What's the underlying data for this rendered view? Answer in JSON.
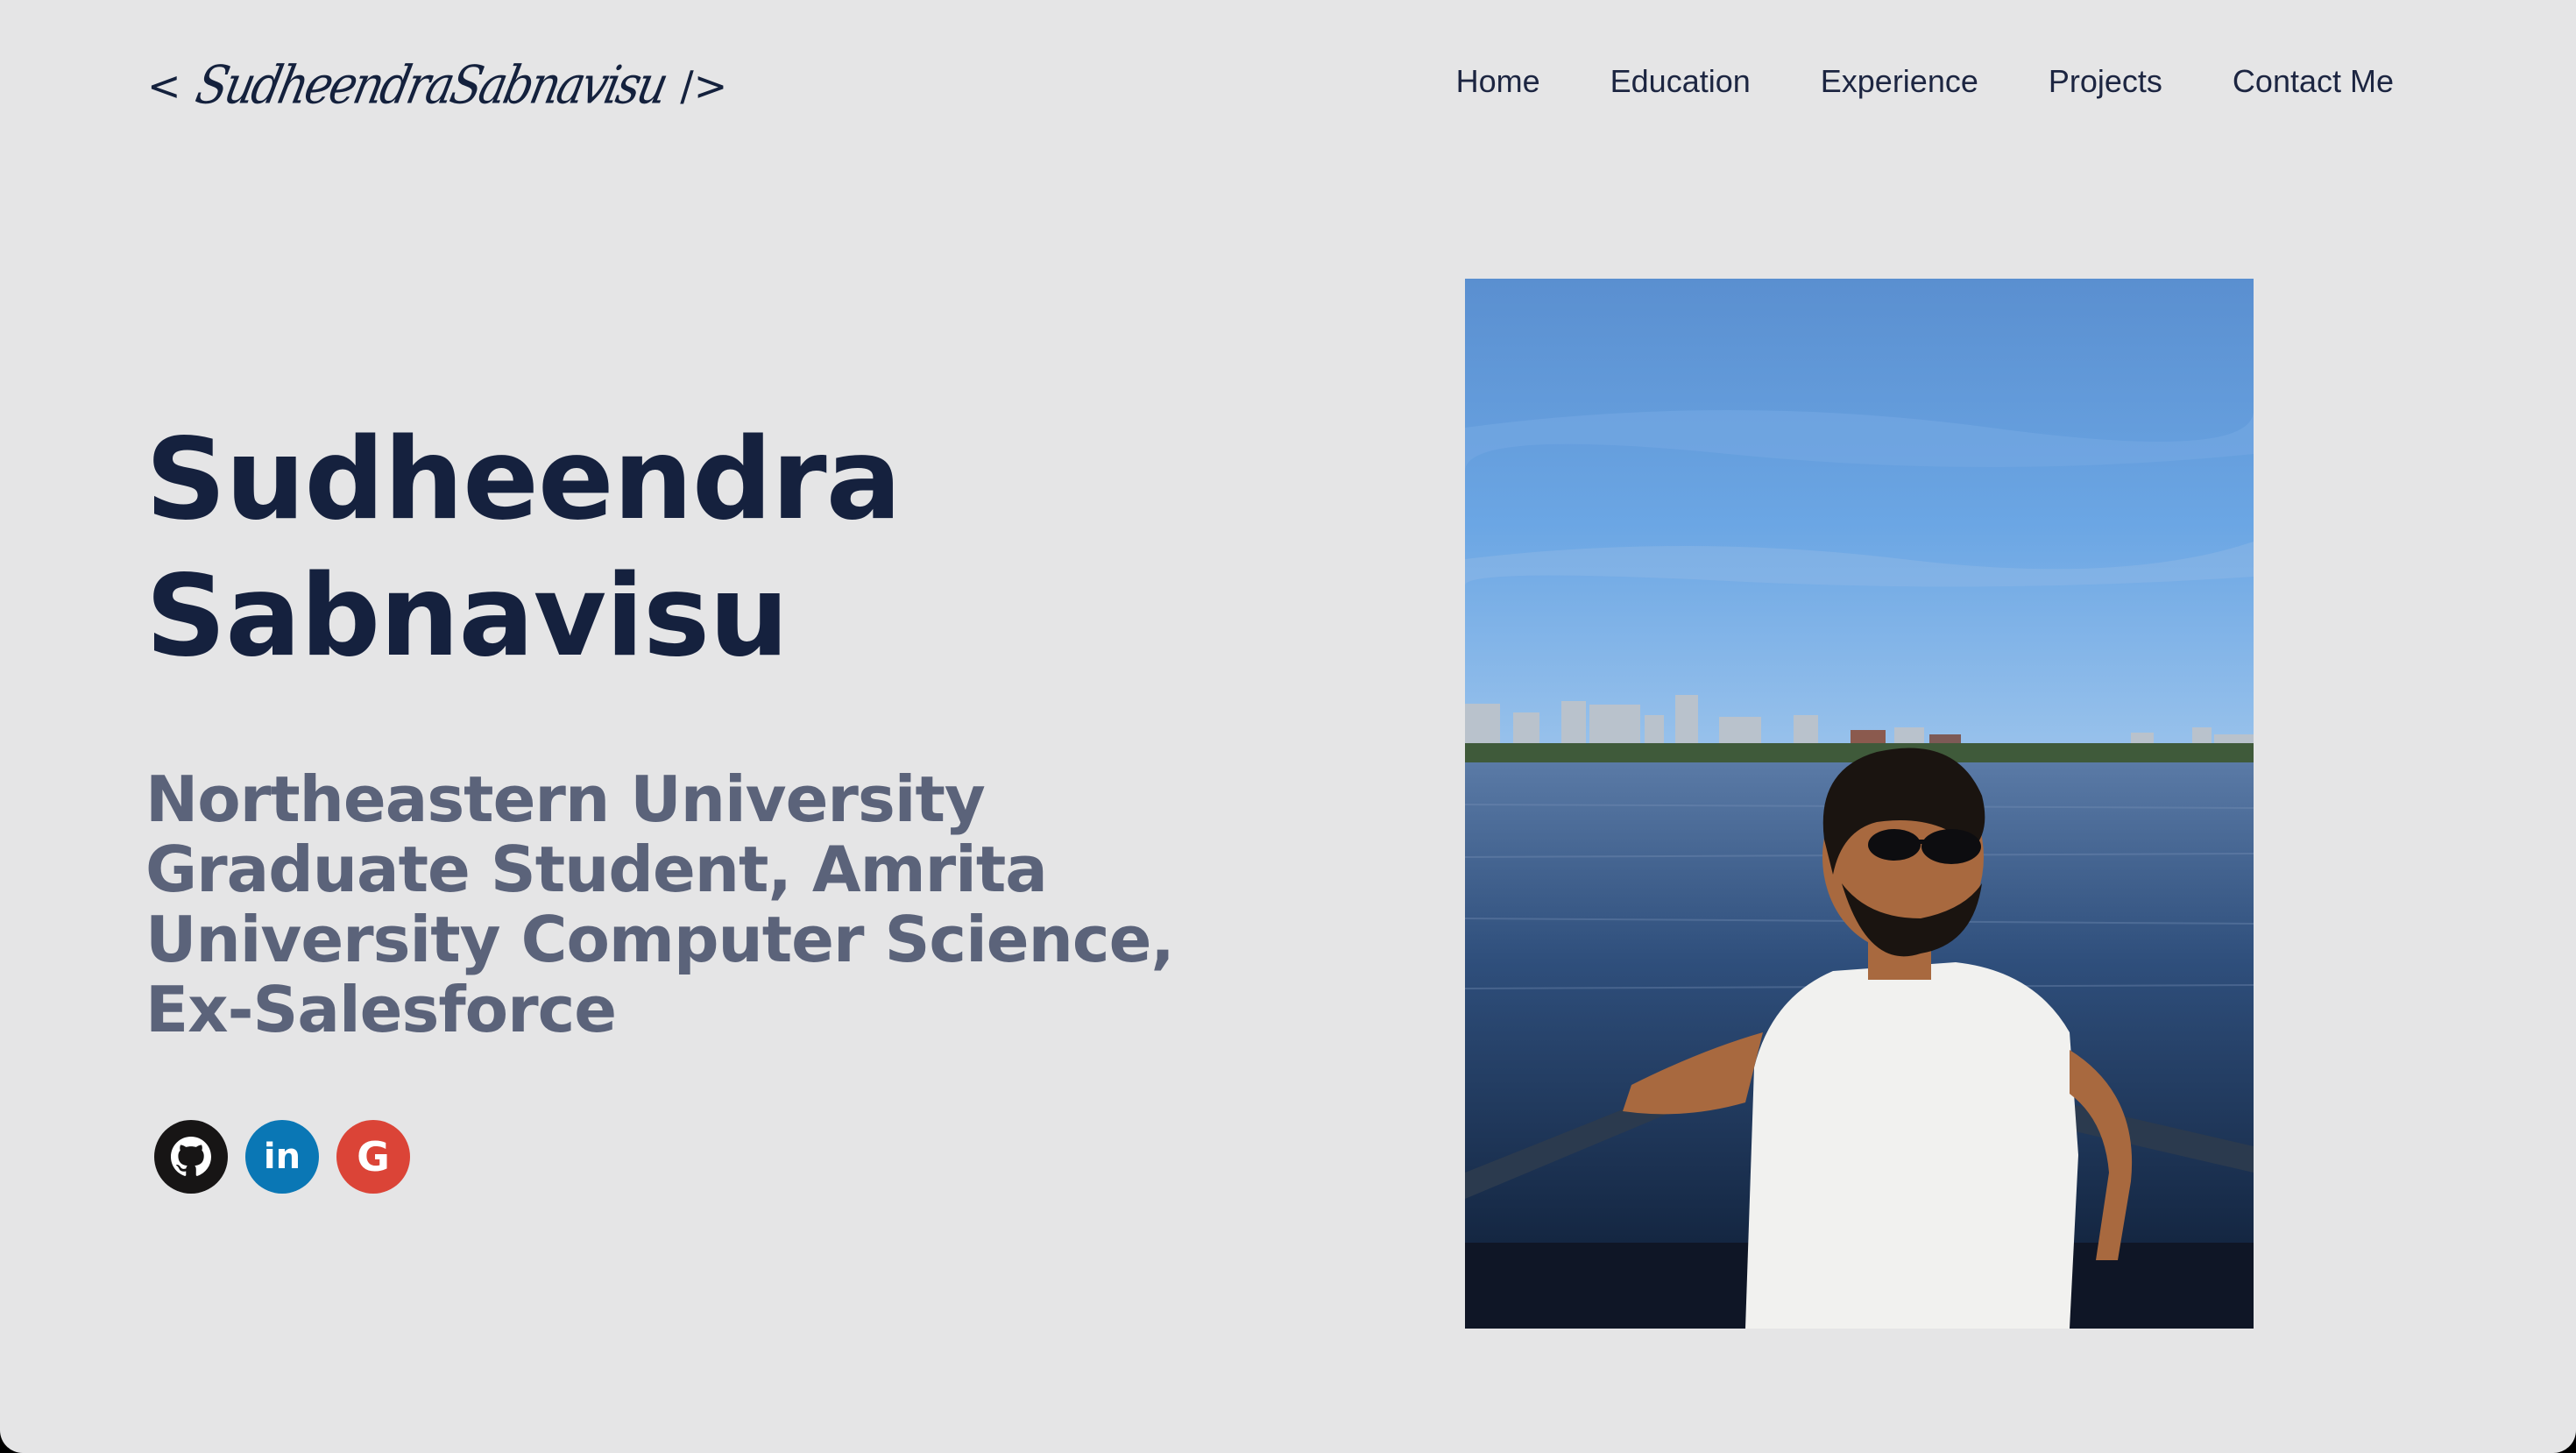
{
  "logo": {
    "open_bracket": "<",
    "signature": "SudheendraSabnavisu",
    "close_bracket": "/>"
  },
  "nav": {
    "items": [
      {
        "label": "Home"
      },
      {
        "label": "Education"
      },
      {
        "label": "Experience"
      },
      {
        "label": "Projects"
      },
      {
        "label": "Contact Me"
      }
    ]
  },
  "hero": {
    "name_line1": "Sudheendra",
    "name_line2": "Sabnavisu",
    "tagline": "Northeastern University Graduate Student, Amrita University Computer Science, Ex-Salesforce"
  },
  "socials": [
    {
      "name": "github",
      "icon": "github-icon",
      "color": "#171515"
    },
    {
      "name": "linkedin",
      "icon": "linkedin-icon",
      "label": "in",
      "color": "#0a77b5"
    },
    {
      "name": "google",
      "icon": "google-icon",
      "label": "G",
      "color": "#db4437"
    }
  ],
  "colors": {
    "background": "#e5e5e6",
    "heading": "#15213e",
    "tagline": "#5b637a",
    "nav": "#1c2541"
  }
}
